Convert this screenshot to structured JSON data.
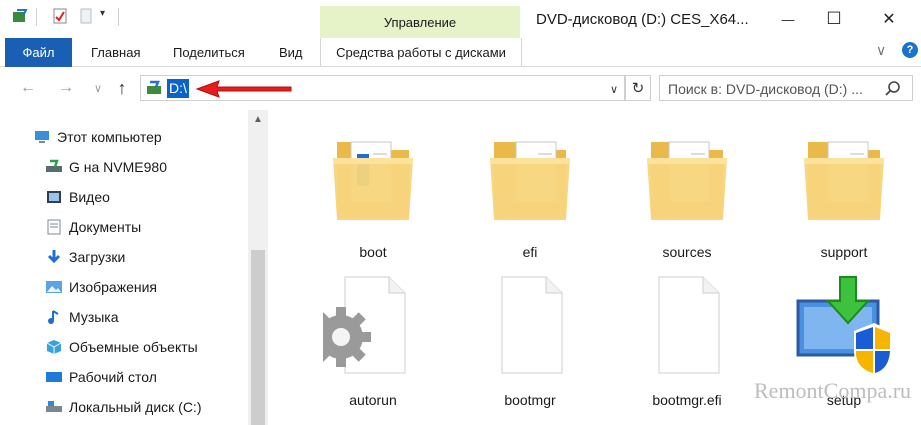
{
  "window": {
    "title": "DVD-дисковод (D:) CES_X64...",
    "context_tab": "Управление",
    "minimize": "—",
    "maximize": "☐",
    "close": "✕"
  },
  "ribbon": {
    "tabs": [
      "Файл",
      "Главная",
      "Поделиться",
      "Вид"
    ],
    "context_tool": "Средства работы с дисками",
    "collapse": "∨",
    "help": "?"
  },
  "nav": {
    "address": "D:\\",
    "search_placeholder": "Поиск в: DVD-дисковод (D:) ...",
    "icons": [
      "back-icon",
      "forward-icon",
      "recent-dropdown-icon",
      "up-icon",
      "refresh-icon",
      "search-icon"
    ]
  },
  "tree": [
    {
      "label": "Этот компьютер",
      "icon": "computer-icon"
    },
    {
      "label": "G на NVME980",
      "icon": "network-drive-icon"
    },
    {
      "label": "Видео",
      "icon": "video-icon"
    },
    {
      "label": "Документы",
      "icon": "documents-icon"
    },
    {
      "label": "Загрузки",
      "icon": "downloads-icon"
    },
    {
      "label": "Изображения",
      "icon": "pictures-icon"
    },
    {
      "label": "Музыка",
      "icon": "music-icon"
    },
    {
      "label": "Объемные объекты",
      "icon": "3d-objects-icon"
    },
    {
      "label": "Рабочий стол",
      "icon": "desktop-icon"
    },
    {
      "label": "Локальный диск (C:)",
      "icon": "local-disk-icon"
    }
  ],
  "files": [
    {
      "name": "boot",
      "type": "folder"
    },
    {
      "name": "efi",
      "type": "folder"
    },
    {
      "name": "sources",
      "type": "folder"
    },
    {
      "name": "support",
      "type": "folder"
    },
    {
      "name": "autorun",
      "type": "settings-file"
    },
    {
      "name": "bootmgr",
      "type": "file"
    },
    {
      "name": "bootmgr.efi",
      "type": "file"
    },
    {
      "name": "setup",
      "type": "setup-exe"
    }
  ],
  "watermark": "RemontCompa.ru",
  "colors": {
    "accent": "#1a5fb4",
    "context_tab": "#e6f3c9",
    "selection": "#0a64c8",
    "folder": "#f5d47a",
    "arrow": "#e81c1c"
  }
}
